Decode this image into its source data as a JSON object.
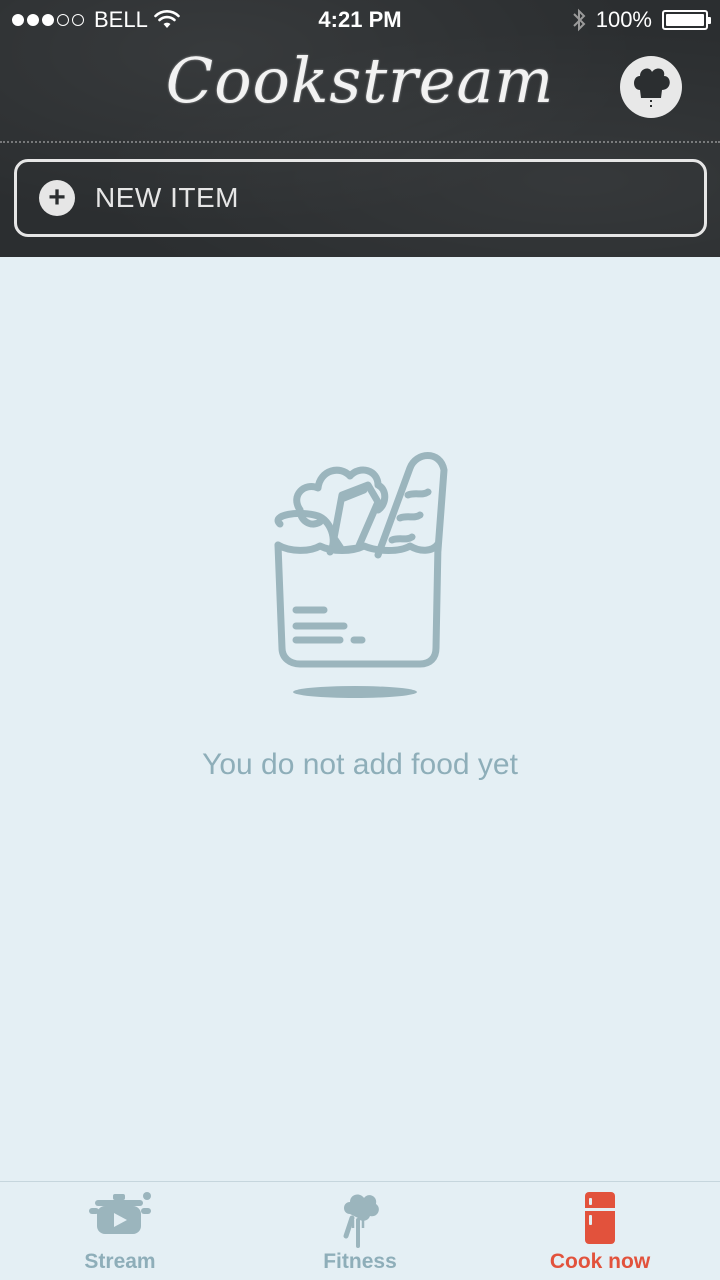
{
  "status_bar": {
    "carrier": "BELL",
    "time": "4:21 PM",
    "battery": "100%",
    "signal_strength": 3
  },
  "header": {
    "title": "Cookstream",
    "profile_icon": "chef-hat-icon"
  },
  "new_item": {
    "label": "NEW ITEM",
    "icon": "plus-circle-icon"
  },
  "empty_state": {
    "icon": "grocery-bag-icon",
    "message": "You do not add food yet"
  },
  "tabs": [
    {
      "label": "Stream",
      "icon": "cooking-pot-icon",
      "active": false
    },
    {
      "label": "Fitness",
      "icon": "broccoli-fork-icon",
      "active": false
    },
    {
      "label": "Cook now",
      "icon": "fridge-icon",
      "active": true
    }
  ],
  "colors": {
    "header_bg": "#2b2e30",
    "page_bg": "#e4eff4",
    "muted": "#8eaeb9",
    "accent": "#e2523c"
  }
}
